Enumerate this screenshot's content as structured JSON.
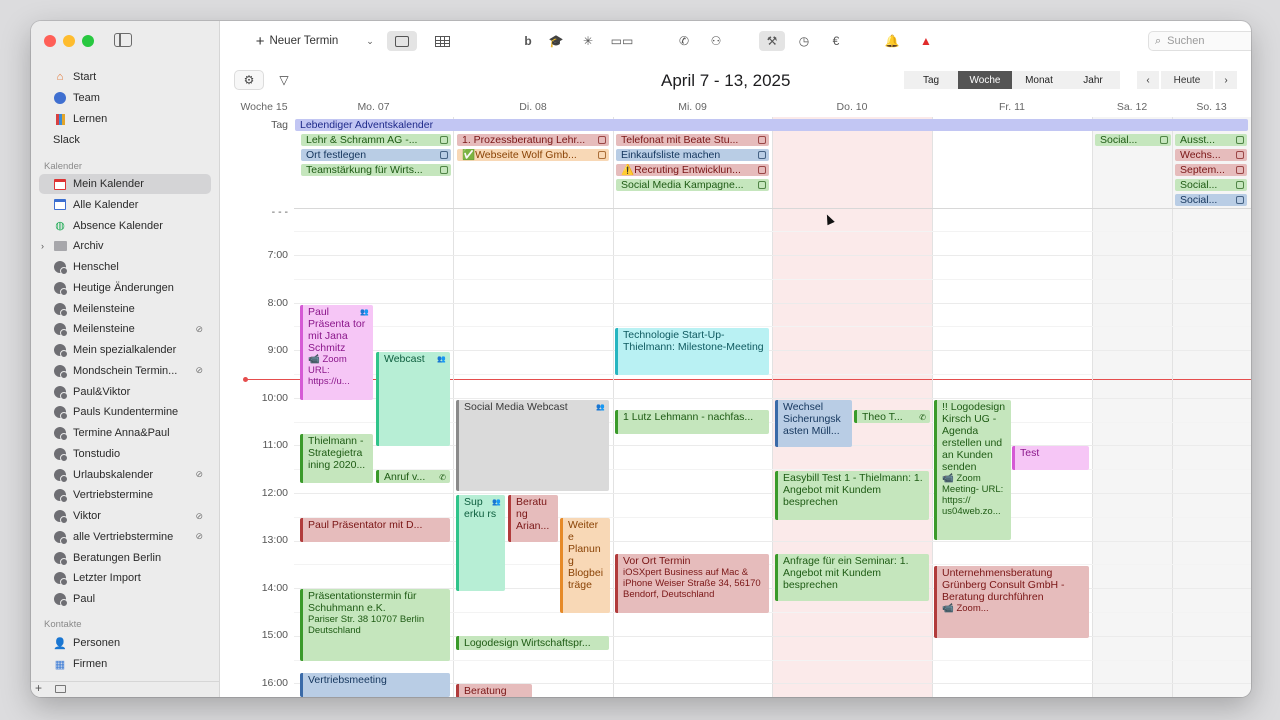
{
  "sidebar": {
    "items_top": [
      {
        "label": "Start",
        "icon": "home-icon"
      },
      {
        "label": "Team",
        "icon": "team-icon"
      },
      {
        "label": "Lernen",
        "icon": "books-icon"
      },
      {
        "label": "Slack",
        "icon": ""
      }
    ],
    "kalender_heading": "Kalender",
    "kalender": [
      {
        "label": "Mein Kalender",
        "icon": "calendar-red-icon",
        "selected": true
      },
      {
        "label": "Alle Kalender",
        "icon": "calendar-blue-icon"
      },
      {
        "label": "Absence Kalender",
        "icon": "absence-icon"
      },
      {
        "label": "Archiv",
        "icon": "folder-icon"
      },
      {
        "label": "Henschel",
        "icon": "user-icon"
      },
      {
        "label": "Heutige Änderungen",
        "icon": "user-icon"
      },
      {
        "label": "Meilensteine",
        "icon": "user-icon"
      },
      {
        "label": "Meilensteine",
        "icon": "user-icon",
        "shared": true
      },
      {
        "label": "Mein spezialkalender",
        "icon": "user-icon"
      },
      {
        "label": "Mondschein Termin...",
        "icon": "user-icon",
        "shared": true
      },
      {
        "label": "Paul&Viktor",
        "icon": "user-icon"
      },
      {
        "label": "Pauls Kundentermine",
        "icon": "user-icon"
      },
      {
        "label": "Termine Anna&Paul",
        "icon": "user-icon"
      },
      {
        "label": "Tonstudio",
        "icon": "user-icon"
      },
      {
        "label": "Urlaubskalender",
        "icon": "user-icon",
        "shared": true
      },
      {
        "label": "Vertriebstermine",
        "icon": "user-icon"
      },
      {
        "label": "Viktor",
        "icon": "user-icon",
        "shared": true
      },
      {
        "label": "alle Vertriebstermine",
        "icon": "user-icon",
        "shared": true
      },
      {
        "label": "Beratungen Berlin",
        "icon": "user-icon"
      },
      {
        "label": "Letzter Import",
        "icon": "user-icon"
      },
      {
        "label": "Paul",
        "icon": "user-icon"
      }
    ],
    "kontakte_heading": "Kontakte",
    "kontakte": [
      {
        "label": "Personen",
        "icon": "person-icon"
      },
      {
        "label": "Firmen",
        "icon": "company-icon"
      }
    ],
    "add_label": "+"
  },
  "toolbar": {
    "new_label": "Neuer Termin",
    "search_placeholder": "Suchen"
  },
  "nav": {
    "title": "April 7 - 13, 2025",
    "views": [
      "Tag",
      "Woche",
      "Monat",
      "Jahr"
    ],
    "active_view": "Woche",
    "today": "Heute",
    "prev": "‹",
    "next": "›"
  },
  "week_label": "Woche 15",
  "allday_label": "Tag",
  "days": [
    "Mo. 07",
    "Di. 08",
    "Mi. 09",
    "Do. 10",
    "Fr. 11",
    "Sa. 12",
    "So. 13"
  ],
  "hours": [
    "- - -",
    "7:00",
    "8:00",
    "9:00",
    "10:00",
    "11:00",
    "12:00",
    "13:00",
    "14:00",
    "15:00",
    "16:00"
  ],
  "allday_events": [
    {
      "text": "Lebendiger Adventskalender",
      "color": "ppl"
    },
    {
      "text": "Lehr & Schramm AG -...",
      "color": "grn"
    },
    {
      "text": "Ort festlegen",
      "color": "blu"
    },
    {
      "text": "Teamstärkung für Wirts...",
      "color": "grn"
    },
    {
      "text": "1. Prozessberatung Lehr...",
      "color": "red"
    },
    {
      "text": "✅Webseite Wolf Gmb...",
      "color": "org"
    },
    {
      "text": "Telefonat mit Beate Stu...",
      "color": "red"
    },
    {
      "text": "Einkaufsliste machen",
      "color": "blu"
    },
    {
      "text": "⚠️Recruting Entwicklun...",
      "color": "red"
    },
    {
      "text": "Social Media Kampagne...",
      "color": "grn"
    },
    {
      "text": "Social...",
      "color": "grn"
    },
    {
      "text": "Ausst...",
      "color": "grn"
    },
    {
      "text": "Wechs...",
      "color": "red"
    },
    {
      "text": "Septem...",
      "color": "red"
    },
    {
      "text": "Social...",
      "color": "grn"
    },
    {
      "text": "Social...",
      "color": "blu"
    }
  ],
  "events": [
    {
      "title": "Paul Präsenta tor mit Jana Schmitz",
      "extra": "📹 Zoom URL: https://u...",
      "color": "pnk"
    },
    {
      "title": "Webcast",
      "extra": "",
      "color": "mnt"
    },
    {
      "title": "Thielmann - Strategietra ining 2020...",
      "extra": "",
      "color": "grn"
    },
    {
      "title": "Anruf v...",
      "extra": "",
      "color": "grn"
    },
    {
      "title": "Paul Präsentator mit D...",
      "extra": "",
      "color": "red"
    },
    {
      "title": "Präsentationstermin für Schuhmann e.K.",
      "extra": "Pariser Str. 38 10707 Berlin Deutschland",
      "color": "grn"
    },
    {
      "title": "Vertriebsmeeting",
      "extra": "",
      "color": "blu"
    },
    {
      "title": "Social Media Webcast",
      "extra": "",
      "color": "gry"
    },
    {
      "title": "Sup erku rs",
      "extra": "",
      "color": "mnt"
    },
    {
      "title": "Beratu ng Arian...",
      "extra": "",
      "color": "red"
    },
    {
      "title": "Weiter e Planun g Blogbei träge",
      "extra": "",
      "color": "org"
    },
    {
      "title": "Logodesign Wirtschaftspr...",
      "extra": "",
      "color": "grn"
    },
    {
      "title": "Beratung",
      "extra": "",
      "color": "red"
    },
    {
      "title": "Technologie Start-Up-Thielmann: Milestone-Meeting",
      "extra": "",
      "color": "cyn"
    },
    {
      "title": "1 Lutz Lehmann - nachfas...",
      "extra": "",
      "color": "grn"
    },
    {
      "title": "Vor Ort Termin",
      "extra": "iOSXpert Business auf Mac & iPhone Weiser Straße 34, 56170 Bendorf, Deutschland",
      "color": "red"
    },
    {
      "title": "Wechsel Sicherungsk asten Müll...",
      "extra": "",
      "color": "blu"
    },
    {
      "title": "Theo T...",
      "extra": "",
      "color": "grn"
    },
    {
      "title": "Easybill Test 1 - Thielmann: 1. Angebot mit Kundem besprechen",
      "extra": "",
      "color": "grn"
    },
    {
      "title": "Anfrage für ein Seminar: 1. Angebot mit Kundem besprechen",
      "extra": "",
      "color": "grn"
    },
    {
      "title": "!! Logodesign Kirsch UG - Agenda erstellen und an Kunden senden",
      "extra": "📹 Zoom Meeting- URL: https:// us04web.zo...",
      "color": "grn"
    },
    {
      "title": "Test",
      "extra": "",
      "color": "pnk"
    },
    {
      "title": "Unternehmensberatung Grünberg Consult GmbH - Beratung durchführen",
      "extra": "📹 Zoom...",
      "color": "red"
    }
  ]
}
